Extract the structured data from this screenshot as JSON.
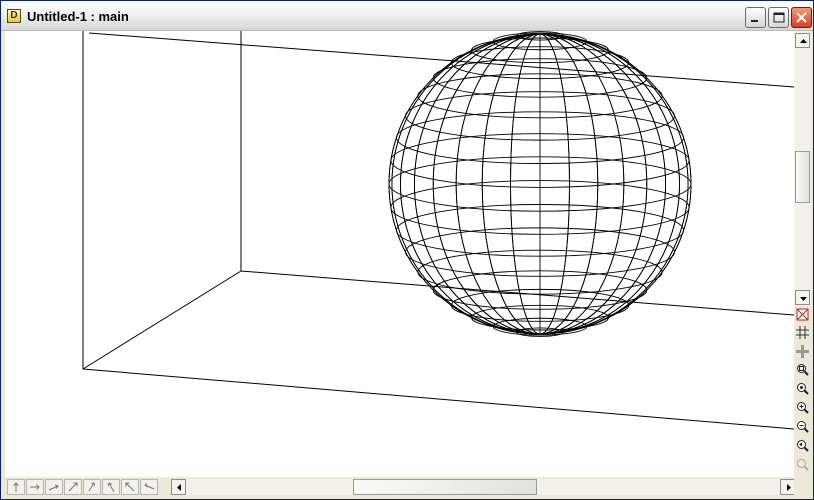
{
  "window": {
    "title": "Untitled-1 : main",
    "app_icon_glyph": "D"
  },
  "title_buttons": [
    "minimize-icon",
    "maximize-icon",
    "close-icon"
  ],
  "viewport": {
    "scene": "wireframe-sphere-in-room",
    "line_color": "#000000",
    "background": "#ffffff"
  },
  "toolbar_right": [
    "no-select-icon",
    "grid-icon",
    "snap-icon",
    "zoom-fit-icon",
    "zoom-selection-icon",
    "zoom-in-icon",
    "zoom-out-icon",
    "zoom-previous-icon",
    "zoom-disabled-icon"
  ],
  "nav_buttons": [
    "move-up-icon",
    "move-right-icon",
    "move-forward-icon",
    "move-diagonal-icon",
    "rotate-up-icon",
    "tilt-icon",
    "pan-diagonal-icon",
    "move-back-icon"
  ],
  "colors": {
    "titlebar_border": "#0a246a",
    "chrome": "#ece9d8",
    "close_red": "#d2412a"
  }
}
